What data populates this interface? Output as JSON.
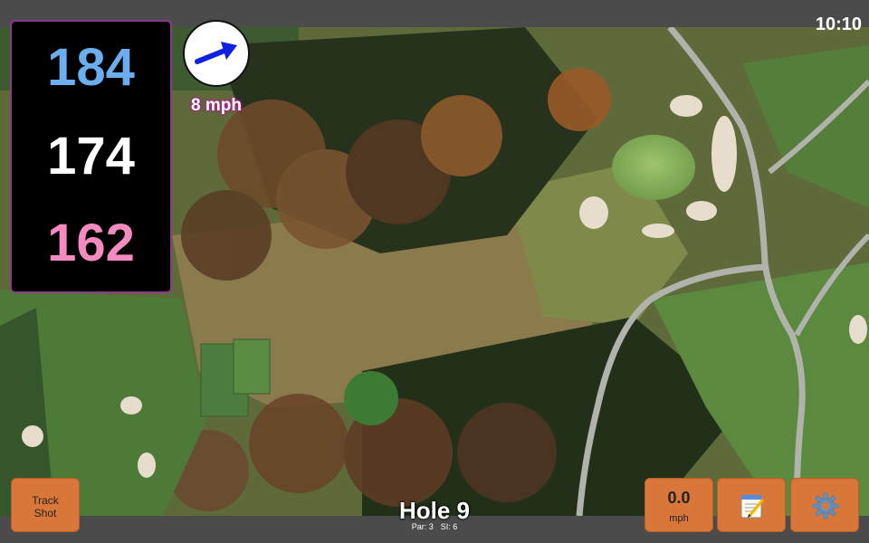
{
  "status": {
    "time": "10:10"
  },
  "distances": {
    "back": "184",
    "middle": "174",
    "front": "162"
  },
  "wind": {
    "speed_label": "8 mph",
    "direction_icon": "arrow-icon"
  },
  "hole": {
    "title": "Hole 9",
    "par": "Par: 3",
    "stroke_index": "SI: 6"
  },
  "buttons": {
    "track_shot_line1": "Track",
    "track_shot_line2": "Shot",
    "speed_value": "0.0",
    "speed_unit": "mph",
    "notes_icon": "notepad-icon",
    "settings_icon": "gear-icon"
  },
  "colors": {
    "back_distance": "#6aaeee",
    "middle_distance": "#ffffff",
    "front_distance": "#f58ac0",
    "button": "#d9773a",
    "wind_text_glow": "#b0208a"
  }
}
